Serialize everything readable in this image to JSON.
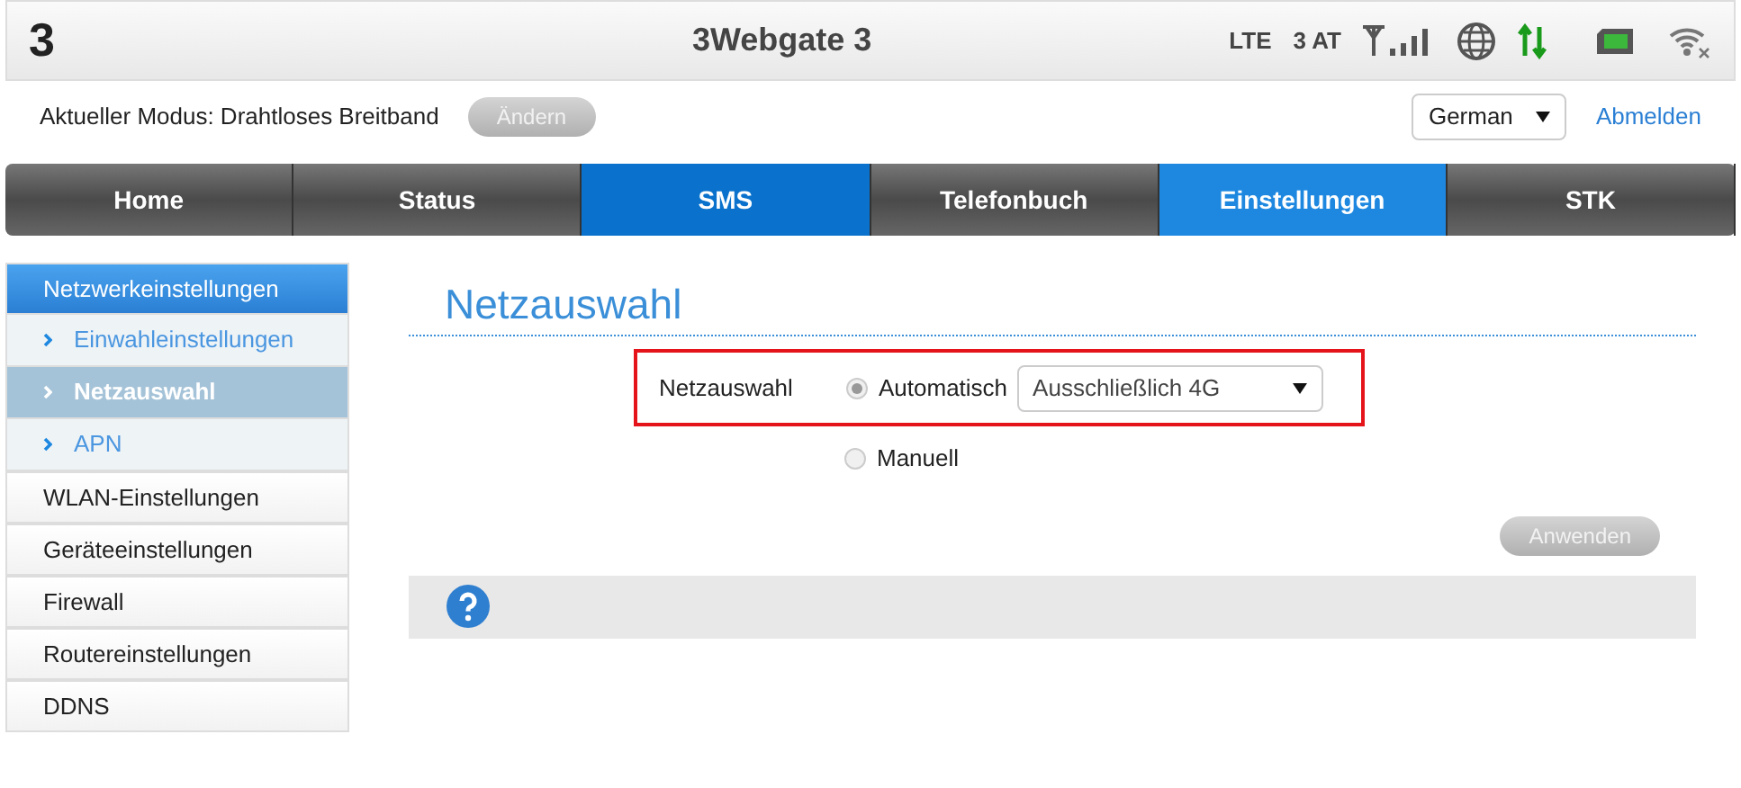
{
  "header": {
    "logo": "3",
    "title": "3Webgate 3",
    "network_type": "LTE",
    "operator": "3 AT"
  },
  "mode": {
    "label": "Aktueller Modus: Drahtloses Breitband",
    "button": {
      "label": "Ändern",
      "disabled": true
    }
  },
  "language": {
    "value": "German"
  },
  "logout": "Abmelden",
  "nav": [
    {
      "label": "Home",
      "selected": false,
      "hovered": false
    },
    {
      "label": "Status",
      "selected": false,
      "hovered": false
    },
    {
      "label": "SMS",
      "selected": false,
      "hovered": true
    },
    {
      "label": "Telefonbuch",
      "selected": false,
      "hovered": false
    },
    {
      "label": "Einstellungen",
      "selected": true,
      "hovered": false
    },
    {
      "label": "STK",
      "selected": false,
      "hovered": false
    }
  ],
  "sidebar": {
    "items": [
      {
        "label": "Netzwerkeinstellungen",
        "selected": true,
        "expanded": true,
        "children": [
          {
            "label": "Einwahleinstellungen",
            "selected": false
          },
          {
            "label": "Netzauswahl",
            "selected": true
          },
          {
            "label": "APN",
            "selected": false
          }
        ]
      },
      {
        "label": "WLAN-Einstellungen",
        "selected": false
      },
      {
        "label": "Geräteeinstellungen",
        "selected": false
      },
      {
        "label": "Firewall",
        "selected": false
      },
      {
        "label": "Routereinstellungen",
        "selected": false
      },
      {
        "label": "DDNS",
        "selected": false
      }
    ]
  },
  "page": {
    "title": "Netzauswahl",
    "field_label": "Netzauswahl",
    "options": [
      {
        "label": "Automatisch",
        "selected": true
      },
      {
        "label": "Manuell",
        "selected": false
      }
    ],
    "mode_select": {
      "value": "Ausschließlich 4G"
    },
    "apply": {
      "label": "Anwenden",
      "disabled": true
    }
  }
}
